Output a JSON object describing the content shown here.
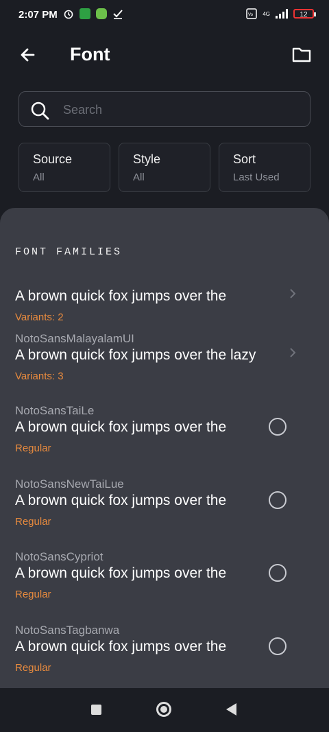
{
  "status_bar": {
    "time": "2:07 PM",
    "network": "4G",
    "battery": "12",
    "colors": {
      "battery_low": "#e33333",
      "app_green": "#2ea043",
      "app_lime": "#6cc04a"
    }
  },
  "header": {
    "title": "Font"
  },
  "search": {
    "placeholder": "Search"
  },
  "filters": [
    {
      "label": "Source",
      "value": "All"
    },
    {
      "label": "Style",
      "value": "All"
    },
    {
      "label": "Sort",
      "value": "Last Used"
    }
  ],
  "section": {
    "title": "FONT FAMILIES"
  },
  "fonts": [
    {
      "name": "",
      "preview": "A brown quick fox jumps over the",
      "detail": "Variants: 2",
      "kind": "chevron"
    },
    {
      "name": "NotoSansMalayalamUI",
      "preview": "A brown quick fox jumps over the lazy",
      "detail": "Variants: 3",
      "kind": "chevron"
    },
    {
      "name": "NotoSansTaiLe",
      "preview": "A brown quick fox jumps over the",
      "detail": "Regular",
      "kind": "radio"
    },
    {
      "name": "NotoSansNewTaiLue",
      "preview": "A brown quick fox jumps over the",
      "detail": "Regular",
      "kind": "radio"
    },
    {
      "name": "NotoSansCypriot",
      "preview": "A brown quick fox jumps over the",
      "detail": "Regular",
      "kind": "radio"
    },
    {
      "name": "NotoSansTagbanwa",
      "preview": "A brown quick fox jumps over the",
      "detail": "Regular",
      "kind": "radio"
    }
  ],
  "colors": {
    "accent": "#e98b3e",
    "background": "#1b1d23",
    "sheet": "#3b3d45"
  }
}
